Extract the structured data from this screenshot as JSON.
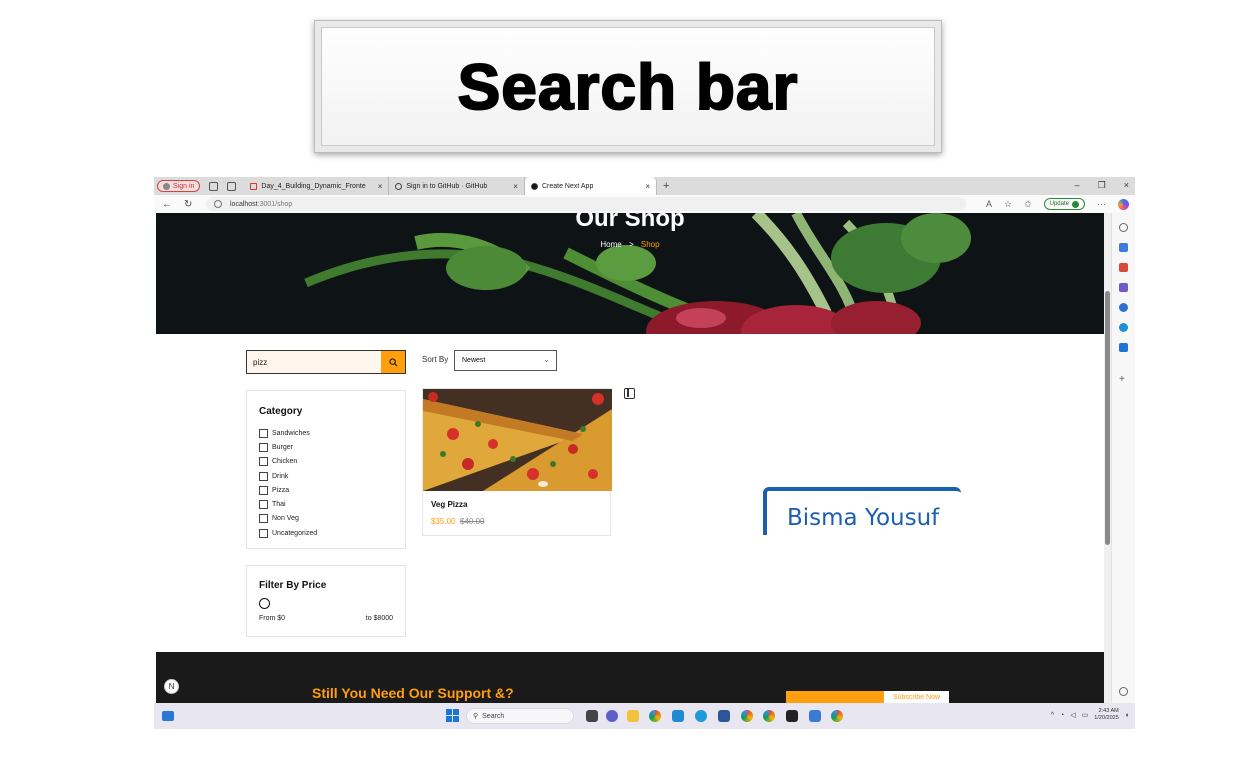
{
  "banner": {
    "title": "Search bar"
  },
  "browser": {
    "signin_label": "Sign in",
    "tabs": [
      {
        "title": "Day_4_Building_Dynamic_Fronte"
      },
      {
        "title": "Sign in to GitHub · GitHub"
      },
      {
        "title": "Create Next App"
      }
    ],
    "tab_close": "×",
    "new_tab": "+",
    "window_controls": [
      "–",
      "❐",
      "×"
    ],
    "url_host": "localhost",
    "url_path": ":3001/shop",
    "update_label": "Update",
    "more_label": "···"
  },
  "hero": {
    "title": "Our Shop",
    "breadcrumb_home": "Home",
    "breadcrumb_sep": ">",
    "breadcrumb_current": "Shop"
  },
  "search": {
    "value": "pizz"
  },
  "sort": {
    "label": "Sort By",
    "selected": "Newest"
  },
  "category": {
    "heading": "Category",
    "items": [
      "Sandwiches",
      "Burger",
      "Chicken",
      "Drink",
      "Pizza",
      "Thai",
      "Non Veg",
      "Uncategorized"
    ]
  },
  "price_filter": {
    "heading": "Filter By Price",
    "from": "From $0",
    "to": "to $8000"
  },
  "product": {
    "name": "Veg Pizza",
    "price": "$35.00",
    "old_price": "$40.00"
  },
  "watermark": {
    "text": "Bisma Yousuf"
  },
  "footer": {
    "support_text": "Still You Need Our Support &?",
    "subscribe_label": "Subscribe Now"
  },
  "taskbar": {
    "search_placeholder": "Search",
    "time": "2:43 AM",
    "date": "1/20/2025"
  },
  "colors": {
    "accent": "#ff9f0d",
    "dark": "#1a1a1a",
    "watermark": "#1c5fb0"
  }
}
